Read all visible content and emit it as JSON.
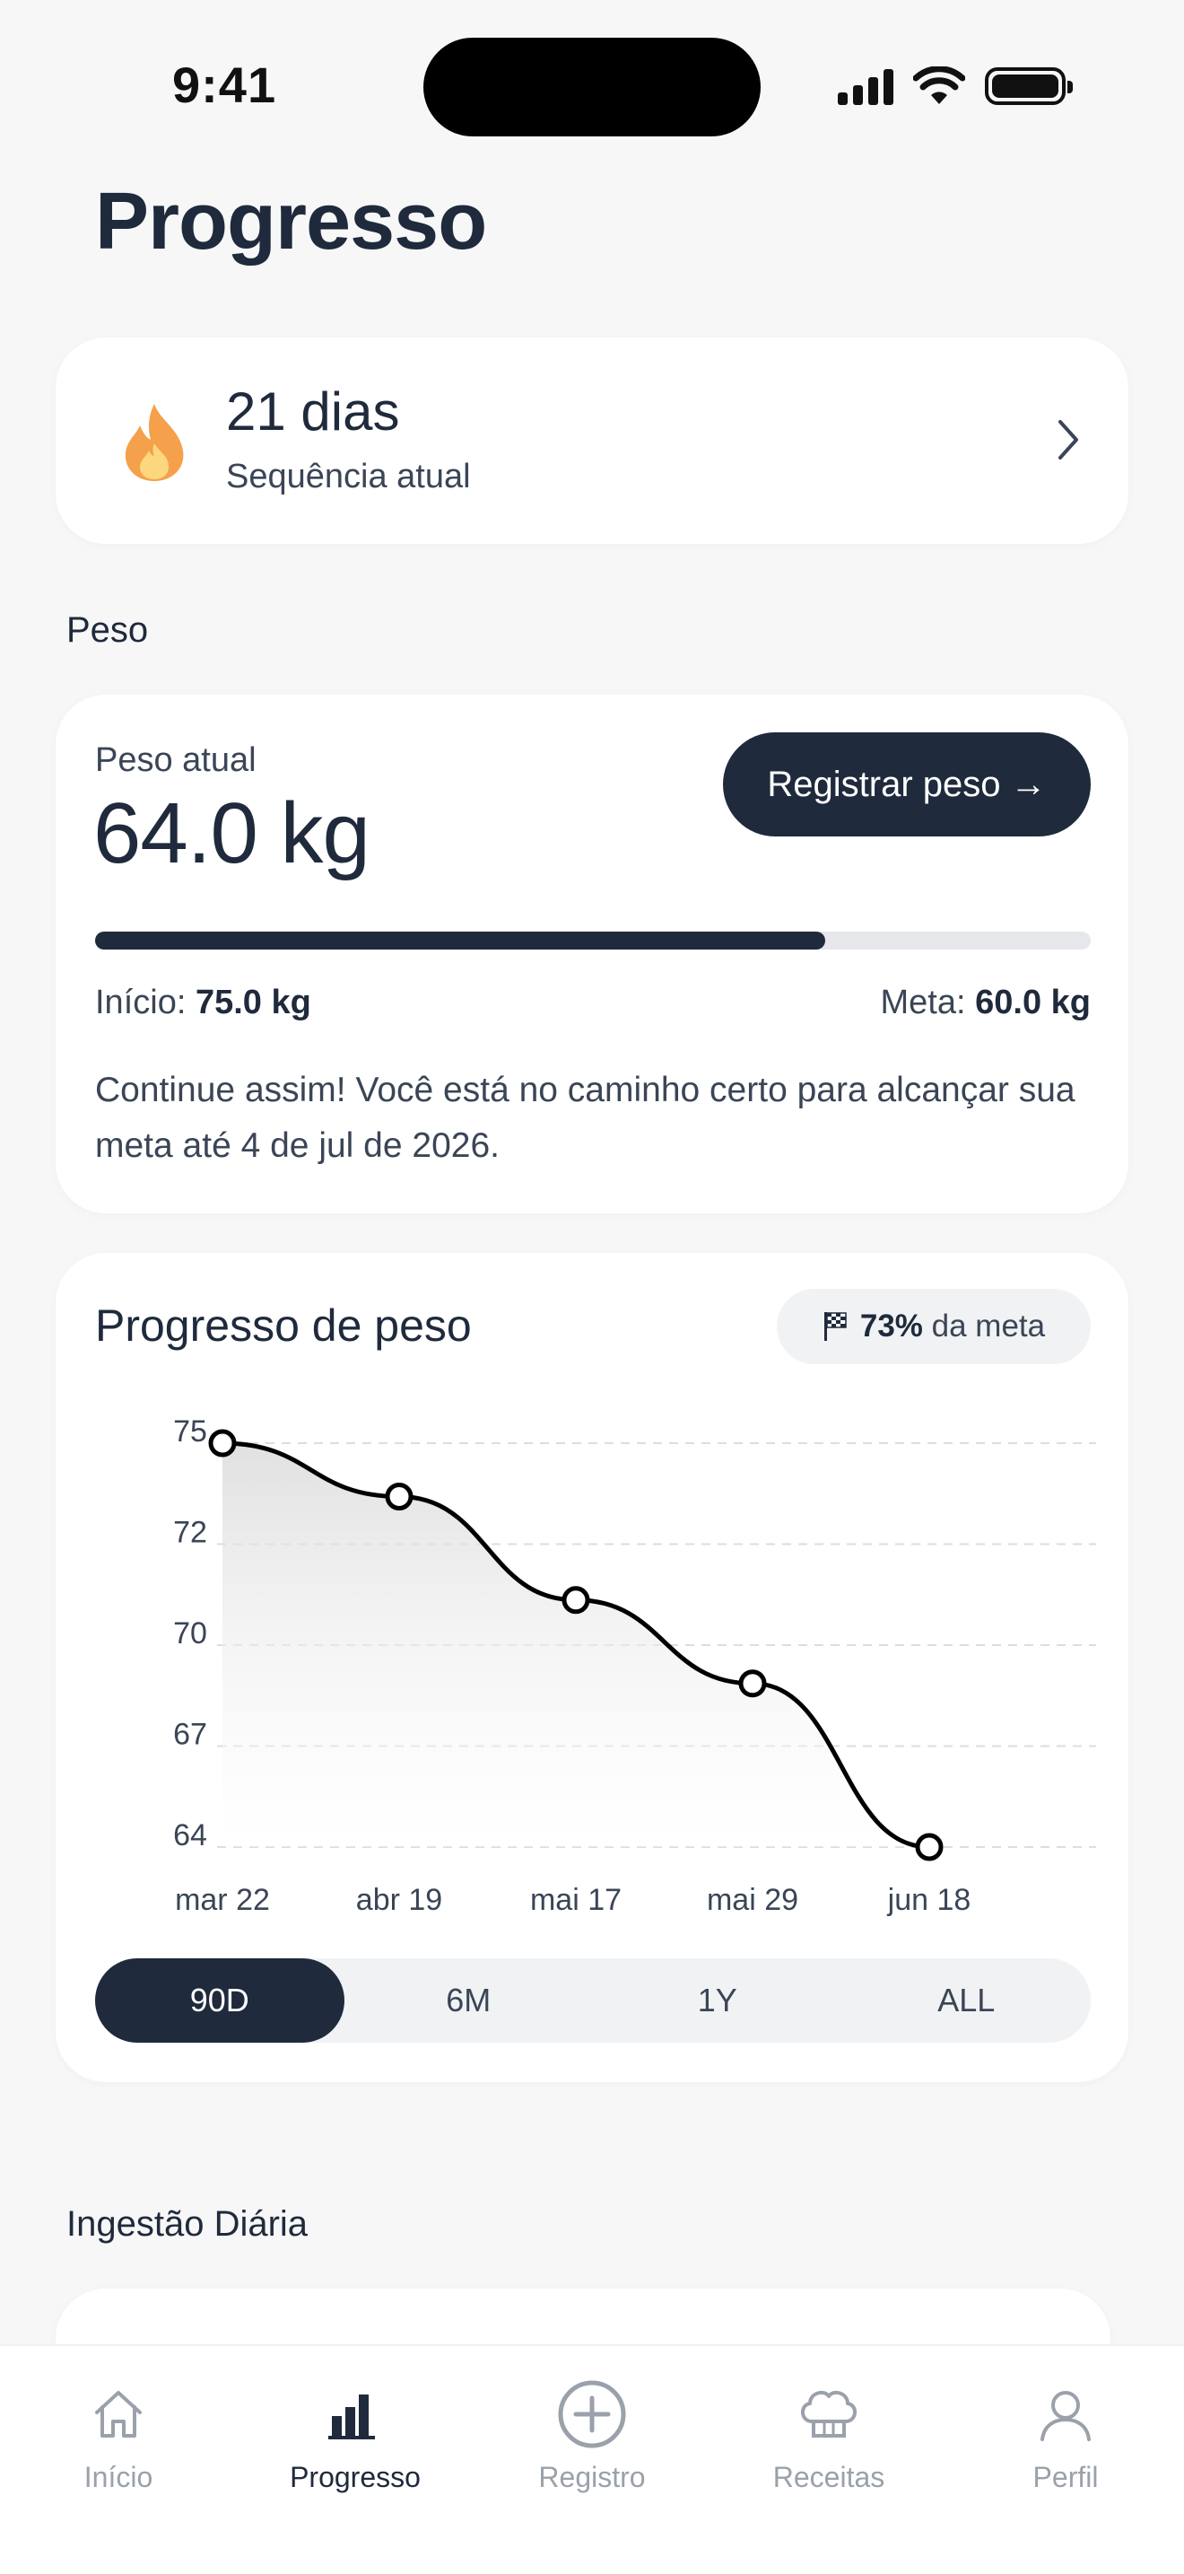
{
  "status_bar": {
    "time": "9:41"
  },
  "page": {
    "title": "Progresso"
  },
  "streak": {
    "days": "21 dias",
    "label": "Sequência atual"
  },
  "sections": {
    "weight": "Peso",
    "intake": "Ingestão Diária"
  },
  "weight": {
    "current_label": "Peso atual",
    "current_value": "64.0 kg",
    "register_button": "Registrar peso →",
    "progress_fraction": 0.733,
    "start_label": "Início:",
    "start_value": "75.0 kg",
    "goal_label": "Meta:",
    "goal_value": "60.0 kg",
    "message": "Continue assim! Você está no caminho certo para alcançar sua meta até 4 de jul de 2026."
  },
  "chart_card": {
    "title": "Progresso de peso",
    "badge_percent": "73%",
    "badge_text": "da meta",
    "ranges": [
      "90D",
      "6M",
      "1Y",
      "ALL"
    ],
    "active_range": "90D"
  },
  "chart_data": {
    "type": "line",
    "categories": [
      "mar 22",
      "abr 19",
      "mai 17",
      "mai 29",
      "jun 18"
    ],
    "values": [
      75.0,
      73.4,
      70.3,
      67.8,
      62.9
    ],
    "ytick_labels": [
      "75",
      "72",
      "70",
      "67",
      "64"
    ],
    "ylim": [
      62.9,
      75.0
    ],
    "grid": true,
    "title": "",
    "xlabel": "",
    "ylabel": ""
  },
  "tab_bar": [
    {
      "label": "Início",
      "icon": "home-icon",
      "active": false
    },
    {
      "label": "Progresso",
      "icon": "bar-chart-icon",
      "active": true
    },
    {
      "label": "Registro",
      "icon": "add-circle-icon",
      "active": false
    },
    {
      "label": "Receitas",
      "icon": "chef-hat-icon",
      "active": false
    },
    {
      "label": "Perfil",
      "icon": "user-icon",
      "active": false
    }
  ],
  "colors": {
    "primary": "#1f2a3c",
    "background": "#f7f7f7",
    "flame": "#f5a04a",
    "inactive": "#9aa1ab"
  }
}
